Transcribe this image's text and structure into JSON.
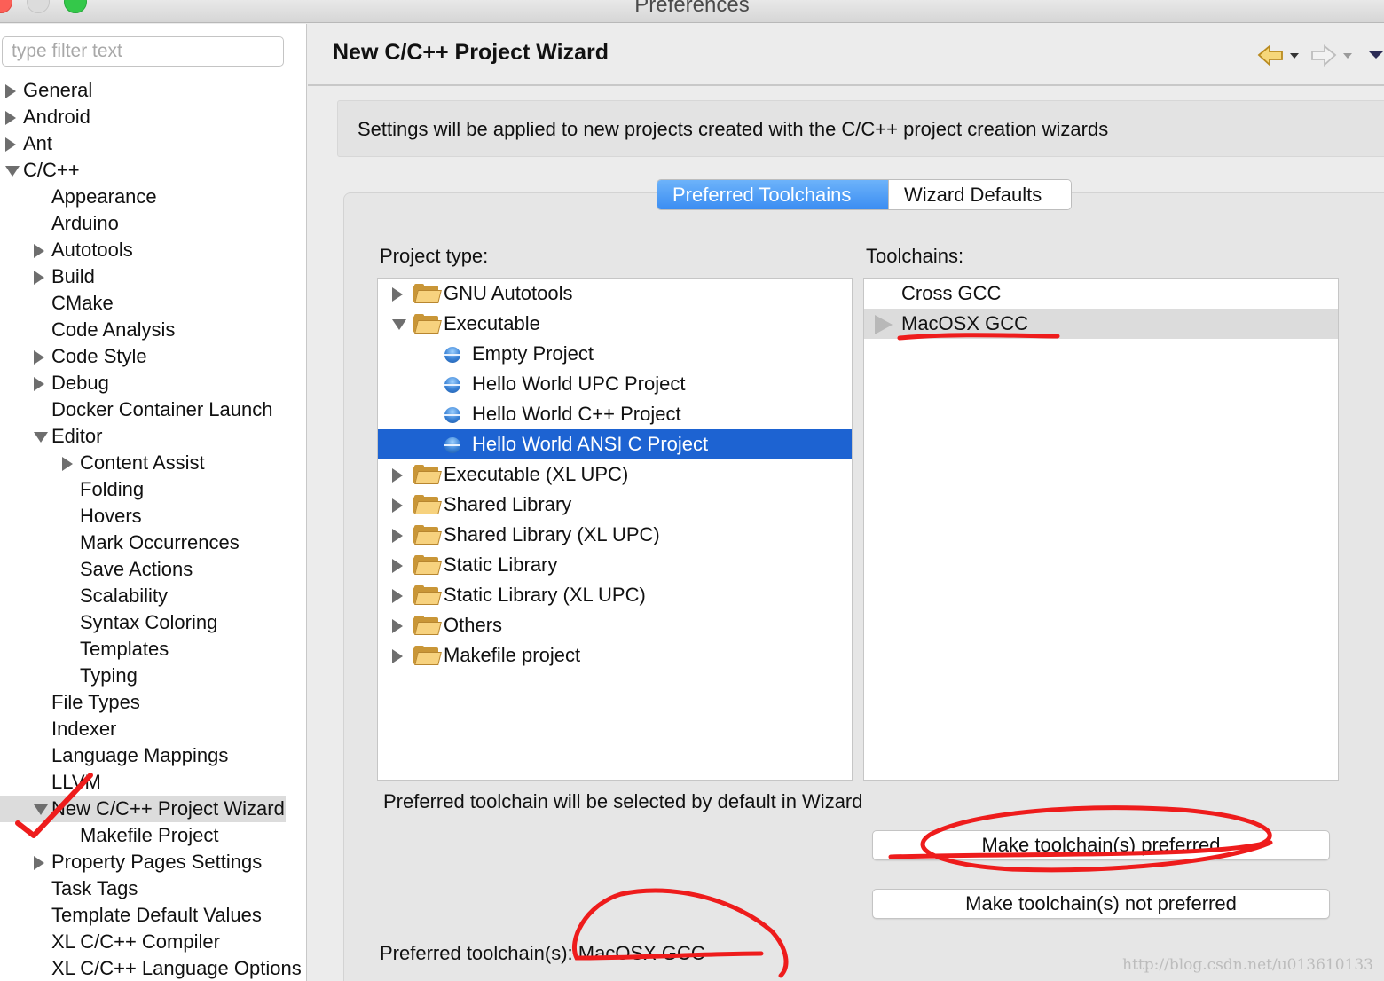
{
  "window": {
    "title": "Preferences"
  },
  "filter": {
    "placeholder": "type filter text"
  },
  "tree": [
    {
      "label": "General",
      "level": 0,
      "state": "closed"
    },
    {
      "label": "Android",
      "level": 0,
      "state": "closed"
    },
    {
      "label": "Ant",
      "level": 0,
      "state": "closed"
    },
    {
      "label": "C/C++",
      "level": 0,
      "state": "open"
    },
    {
      "label": "Appearance",
      "level": 1,
      "state": "leaf"
    },
    {
      "label": "Arduino",
      "level": 1,
      "state": "leaf"
    },
    {
      "label": "Autotools",
      "level": 1,
      "state": "closed"
    },
    {
      "label": "Build",
      "level": 1,
      "state": "closed"
    },
    {
      "label": "CMake",
      "level": 1,
      "state": "leaf"
    },
    {
      "label": "Code Analysis",
      "level": 1,
      "state": "leaf"
    },
    {
      "label": "Code Style",
      "level": 1,
      "state": "closed"
    },
    {
      "label": "Debug",
      "level": 1,
      "state": "closed"
    },
    {
      "label": "Docker Container Launch",
      "level": 1,
      "state": "leaf"
    },
    {
      "label": "Editor",
      "level": 1,
      "state": "open"
    },
    {
      "label": "Content Assist",
      "level": 2,
      "state": "closed"
    },
    {
      "label": "Folding",
      "level": 2,
      "state": "leaf"
    },
    {
      "label": "Hovers",
      "level": 2,
      "state": "leaf"
    },
    {
      "label": "Mark Occurrences",
      "level": 2,
      "state": "leaf"
    },
    {
      "label": "Save Actions",
      "level": 2,
      "state": "leaf"
    },
    {
      "label": "Scalability",
      "level": 2,
      "state": "leaf"
    },
    {
      "label": "Syntax Coloring",
      "level": 2,
      "state": "leaf"
    },
    {
      "label": "Templates",
      "level": 2,
      "state": "leaf"
    },
    {
      "label": "Typing",
      "level": 2,
      "state": "leaf"
    },
    {
      "label": "File Types",
      "level": 1,
      "state": "leaf"
    },
    {
      "label": "Indexer",
      "level": 1,
      "state": "leaf"
    },
    {
      "label": "Language Mappings",
      "level": 1,
      "state": "leaf"
    },
    {
      "label": "LLVM",
      "level": 1,
      "state": "leaf"
    },
    {
      "label": "New C/C++ Project Wizard",
      "level": 1,
      "state": "open",
      "selected": true
    },
    {
      "label": "Makefile Project",
      "level": 2,
      "state": "leaf"
    },
    {
      "label": "Property Pages Settings",
      "level": 1,
      "state": "closed"
    },
    {
      "label": "Task Tags",
      "level": 1,
      "state": "leaf"
    },
    {
      "label": "Template Default Values",
      "level": 1,
      "state": "leaf"
    },
    {
      "label": "XL C/C++ Compiler",
      "level": 1,
      "state": "leaf"
    },
    {
      "label": "XL C/C++ Language Options",
      "level": 1,
      "state": "leaf"
    }
  ],
  "page": {
    "title": "New C/C++ Project Wizard",
    "description": "Settings will be applied to new projects created with the C/C++ project creation wizards",
    "tabs": [
      {
        "label": "Preferred Toolchains",
        "active": true
      },
      {
        "label": "Wizard Defaults",
        "active": false
      }
    ],
    "project_type_label": "Project type:",
    "toolchains_label": "Toolchains:",
    "project_types": [
      {
        "label": "GNU Autotools",
        "kind": "folder",
        "state": "closed",
        "level": 0
      },
      {
        "label": "Executable",
        "kind": "folder",
        "state": "open",
        "level": 0
      },
      {
        "label": "Empty Project",
        "kind": "item",
        "level": 1
      },
      {
        "label": "Hello World UPC Project",
        "kind": "item",
        "level": 1
      },
      {
        "label": "Hello World C++ Project",
        "kind": "item",
        "level": 1
      },
      {
        "label": "Hello World ANSI C Project",
        "kind": "item",
        "level": 1,
        "selected": true
      },
      {
        "label": "Executable (XL UPC)",
        "kind": "folder",
        "state": "closed",
        "level": 0
      },
      {
        "label": "Shared Library",
        "kind": "folder",
        "state": "closed",
        "level": 0
      },
      {
        "label": "Shared Library (XL UPC)",
        "kind": "folder",
        "state": "closed",
        "level": 0
      },
      {
        "label": "Static Library",
        "kind": "folder",
        "state": "closed",
        "level": 0
      },
      {
        "label": "Static Library (XL UPC)",
        "kind": "folder",
        "state": "closed",
        "level": 0
      },
      {
        "label": "Others",
        "kind": "folder",
        "state": "closed",
        "level": 0
      },
      {
        "label": "Makefile project",
        "kind": "folder",
        "state": "closed",
        "level": 0
      }
    ],
    "toolchains": [
      {
        "label": "Cross GCC",
        "preferred": false
      },
      {
        "label": "MacOSX GCC",
        "preferred": true
      }
    ],
    "info_text": "Preferred toolchain will be selected by default in Wizard",
    "make_preferred_button": "Make toolchain(s) preferred",
    "make_not_preferred_button": "Make toolchain(s) not preferred",
    "preferred_summary": "Preferred toolchain(s): MacOSX GCC"
  },
  "watermark": "http://blog.csdn.net/u013610133",
  "colors": {
    "selection": "#1d63d2",
    "tab_active": "#3b8df2",
    "annotation": "#ee1c1c"
  },
  "icons": {
    "back": "back-arrow-icon",
    "forward": "forward-arrow-icon",
    "menu": "view-menu-icon"
  }
}
